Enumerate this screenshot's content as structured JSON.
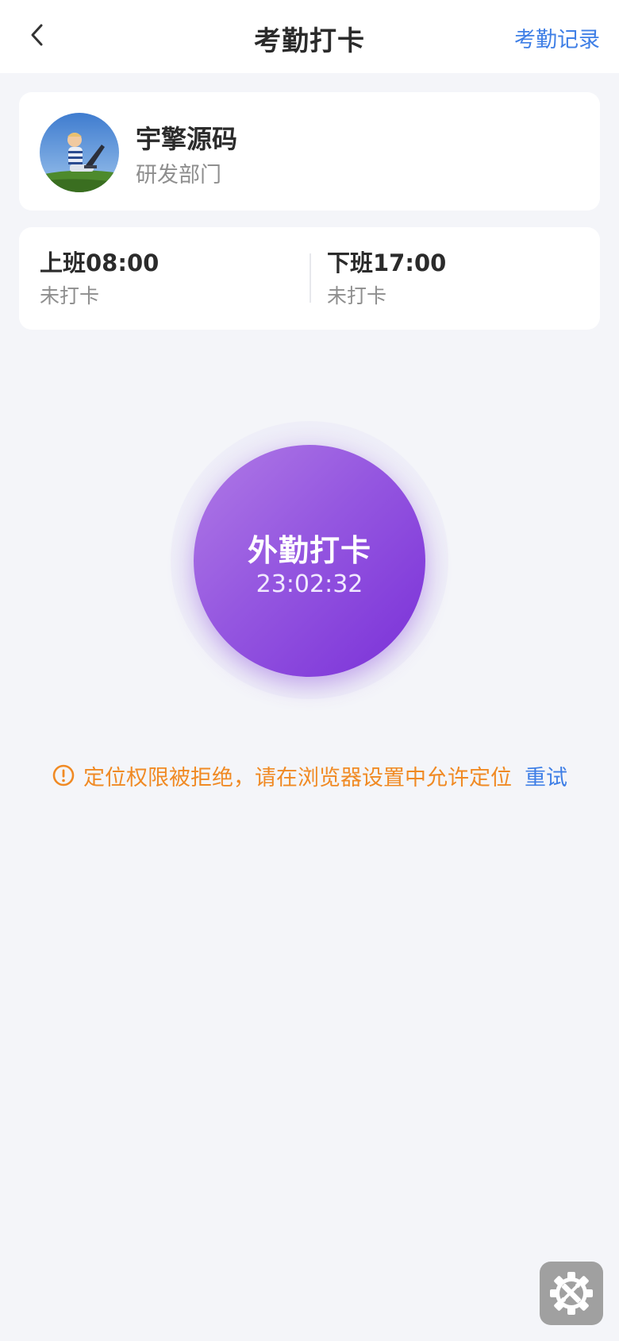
{
  "header": {
    "title": "考勤打卡",
    "records_label": "考勤记录"
  },
  "profile": {
    "name": "宇擎源码",
    "department": "研发部门"
  },
  "shifts": {
    "on_duty": {
      "label": "上班08:00",
      "status": "未打卡"
    },
    "off_duty": {
      "label": "下班17:00",
      "status": "未打卡"
    }
  },
  "punch": {
    "label": "外勤打卡",
    "time": "23:02:32"
  },
  "warning": {
    "message": "定位权限被拒绝，请在浏览器设置中允许定位",
    "retry_label": "重试"
  },
  "colors": {
    "accent": "#3f7fe6",
    "warning": "#f08a24",
    "punch_gradient_start": "#b07ae6",
    "punch_gradient_end": "#7a30d8",
    "background": "#f4f5f9"
  },
  "icons": {
    "back": "chevron-left-icon",
    "warning": "exclamation-circle-icon",
    "tools": "gear-wrench-icon"
  }
}
